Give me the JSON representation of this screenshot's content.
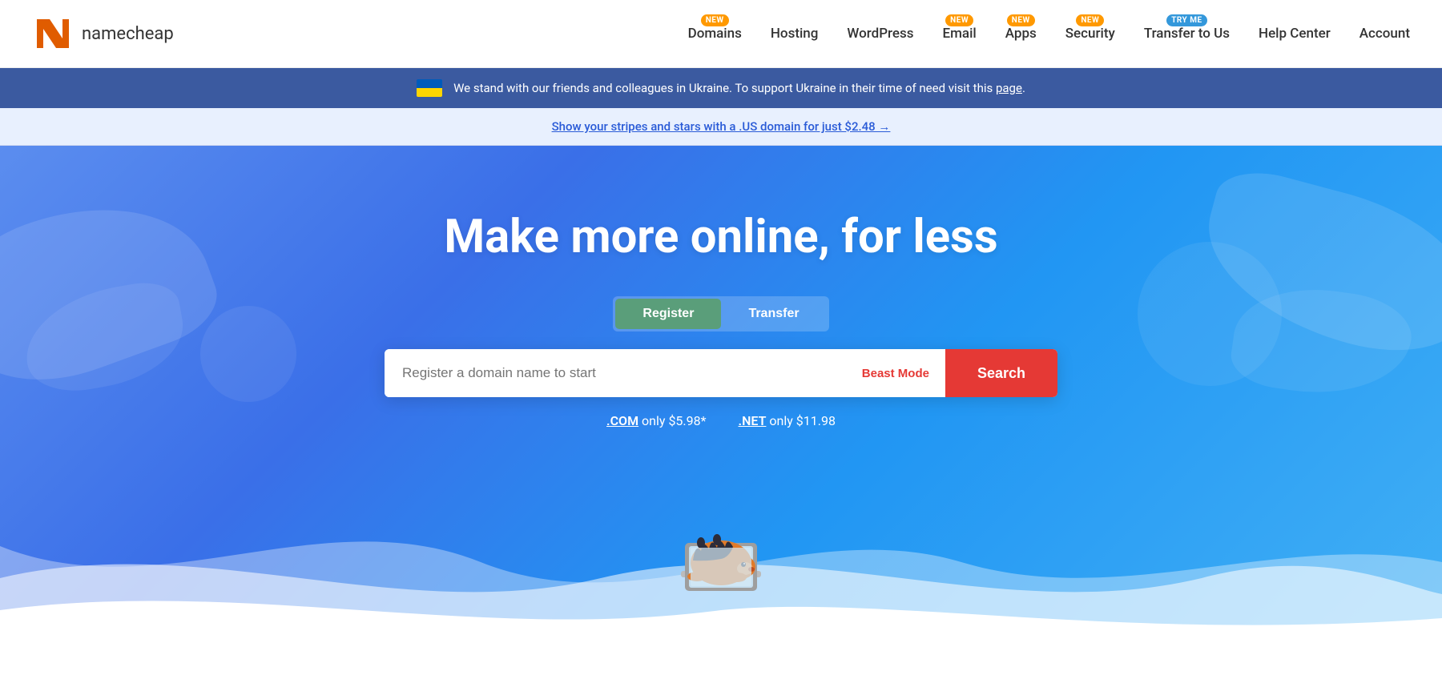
{
  "header": {
    "logo_text": "namecheap",
    "nav": [
      {
        "id": "domains",
        "label": "Domains",
        "badge": "NEW",
        "badge_type": "new"
      },
      {
        "id": "hosting",
        "label": "Hosting",
        "badge": null
      },
      {
        "id": "wordpress",
        "label": "WordPress",
        "badge": null
      },
      {
        "id": "email",
        "label": "Email",
        "badge": "NEW",
        "badge_type": "new"
      },
      {
        "id": "apps",
        "label": "Apps",
        "badge": "NEW",
        "badge_type": "new"
      },
      {
        "id": "security",
        "label": "Security",
        "badge": "NEW",
        "badge_type": "new"
      },
      {
        "id": "transfer",
        "label": "Transfer to Us",
        "badge": "TRY ME",
        "badge_type": "tryme"
      },
      {
        "id": "help",
        "label": "Help Center",
        "badge": null
      },
      {
        "id": "account",
        "label": "Account",
        "badge": null
      }
    ]
  },
  "ukraine_banner": {
    "text": "We stand with our friends and colleagues in Ukraine. To support Ukraine in their time of need visit this ",
    "link_text": "page",
    "link_suffix": "."
  },
  "promo_banner": {
    "text": "Show your stripes and stars with a .US domain for just $2.48 →"
  },
  "hero": {
    "title": "Make more online, for less",
    "tabs": [
      {
        "id": "register",
        "label": "Register",
        "active": true
      },
      {
        "id": "transfer",
        "label": "Transfer",
        "active": false
      }
    ],
    "search_placeholder": "Register a domain name to start",
    "beast_mode_label": "Beast Mode",
    "search_button_label": "Search",
    "price_links": [
      {
        "ext": ".COM",
        "text": " only $5.98*"
      },
      {
        "ext": ".NET",
        "text": " only $11.98"
      }
    ]
  }
}
